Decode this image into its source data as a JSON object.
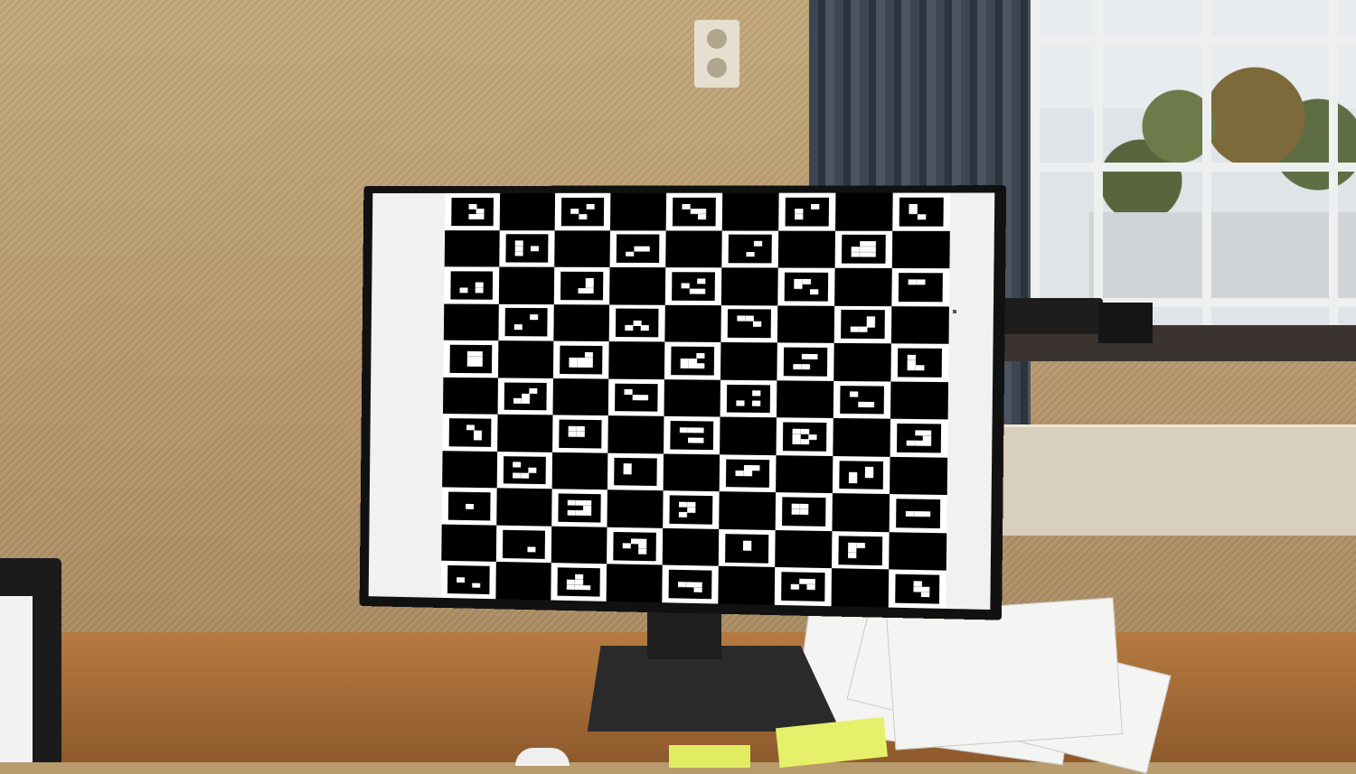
{
  "scene": {
    "description_items": [
      "monitor-displaying-charuco-calibration-board",
      "window",
      "curtain",
      "desk"
    ]
  },
  "calibration_board": {
    "rows": 11,
    "cols": 9,
    "marker_color": "#000000",
    "square_color": "#ffffff"
  },
  "colors": {
    "wall": "#c4a77a",
    "desk": "#b67a41",
    "monitor_bezel": "#111111"
  }
}
